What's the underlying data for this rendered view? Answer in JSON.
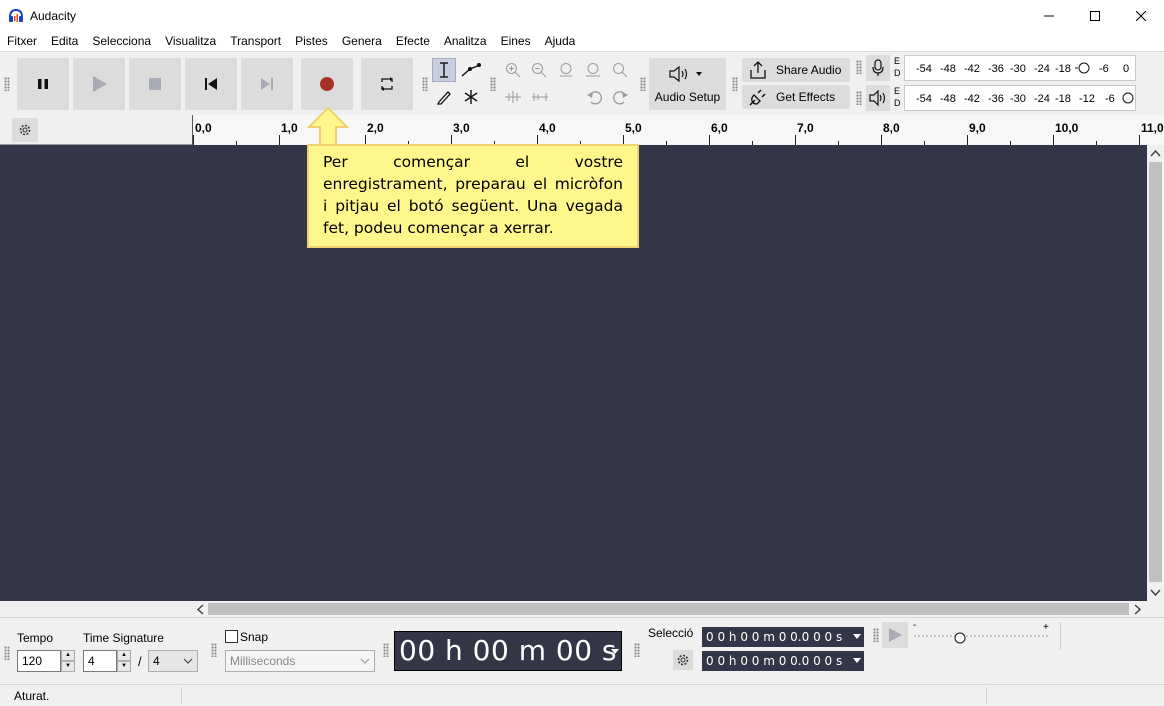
{
  "window": {
    "title": "Audacity"
  },
  "menu": [
    "Fitxer",
    "Edita",
    "Selecciona",
    "Visualitza",
    "Transport",
    "Pistes",
    "Genera",
    "Efecte",
    "Analitza",
    "Eines",
    "Ajuda"
  ],
  "toolbar": {
    "audio_setup_label": "Audio Setup",
    "share_audio_label": "Share Audio",
    "get_effects_label": "Get Effects"
  },
  "meters": {
    "record_scale": [
      "-54",
      "-48",
      "-42",
      "-36",
      "-30",
      "-24",
      "-18",
      "-6",
      "0"
    ],
    "play_scale": [
      "-54",
      "-48",
      "-42",
      "-36",
      "-30",
      "-24",
      "-18",
      "-12",
      "-6"
    ],
    "channel_labels": [
      "E",
      "D"
    ]
  },
  "ruler": {
    "ticks": [
      "0,0",
      "1,0",
      "2,0",
      "3,0",
      "4,0",
      "5,0",
      "6,0",
      "7,0",
      "8,0",
      "9,0",
      "10,0",
      "11,0"
    ]
  },
  "tooltip": {
    "text": "Per començar el vostre enregistrament, preparau el micròfon i pitjau el botó següent. Una vegada fet, podeu començar a xerrar."
  },
  "bottom": {
    "tempo_label": "Tempo",
    "tempo_value": "120",
    "time_signature_label": "Time Signature",
    "ts_numerator": "4",
    "ts_separator": "/",
    "ts_denominator": "4",
    "snap_label": "Snap",
    "snap_unit": "Milliseconds",
    "time_display": "00 h 00 m 00 s",
    "selection_label": "Selecció",
    "selection_start": "0 0 h 0 0 m 0 0.0 0 0 s",
    "selection_end": "0 0 h 0 0 m 0 0.0 0 0 s",
    "speed_minus": "-",
    "speed_plus": "+"
  },
  "status": {
    "text": "Aturat."
  },
  "colors": {
    "track_bg": "#333646",
    "tooltip_bg": "#fff68c",
    "record_red": "#a93226"
  }
}
